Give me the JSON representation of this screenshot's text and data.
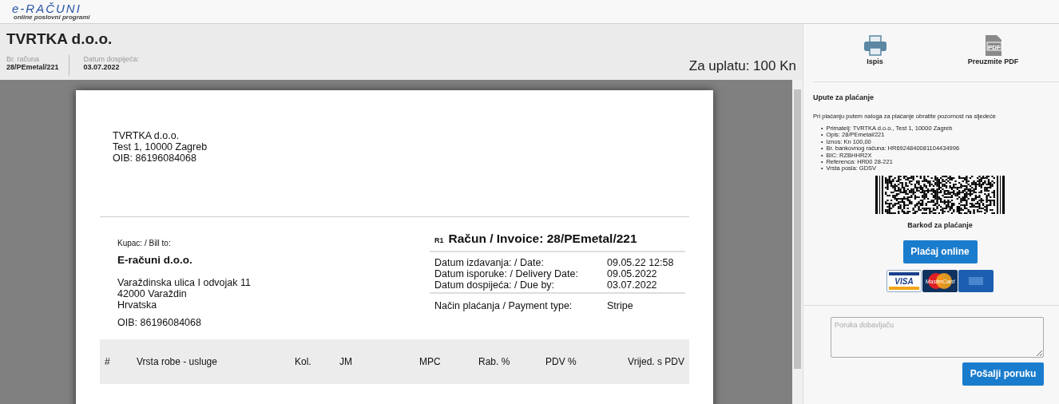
{
  "logo": {
    "name": "e-RAČUNI",
    "tagline": "online poslovni programi"
  },
  "header": {
    "company": "TVRTKA d.o.o.",
    "fields": [
      {
        "label": "Br. računa",
        "value": "28/PEmetal/221"
      },
      {
        "label": "Datum dospijeća:",
        "value": "03.07.2022"
      }
    ],
    "amount_due": "Za uplatu: 100 Kn"
  },
  "document": {
    "seller_lines": [
      "TVRTKA d.o.o.",
      "Test 1, 10000 Zagreb",
      "OIB: 86196084068"
    ],
    "buyer": {
      "label": "Kupac: / Bill to:",
      "name": "E-računi d.o.o.",
      "address_lines": [
        "Varaždinska ulica I odvojak 11",
        "42000 Varaždin",
        "Hrvatska"
      ],
      "oib": "OIB: 86196084068"
    },
    "invoice": {
      "prefix": "R1",
      "title": "Račun / Invoice: 28/PEmetal/221",
      "dates": [
        {
          "label": "Datum izdavanja: / Date:",
          "value": "09.05.22 12:58"
        },
        {
          "label": "Datum isporuke: / Delivery Date:",
          "value": "09.05.2022"
        },
        {
          "label": "Datum dospijeća: / Due by:",
          "value": "03.07.2022"
        }
      ],
      "payment": {
        "label": "Način plaćanja / Payment type:",
        "value": "Stripe"
      }
    },
    "table": {
      "columns": [
        "#",
        "Vrsta robe - usluge",
        "Kol.",
        "JM",
        "MPC",
        "Rab. %",
        "PDV %",
        "Vrijed. s PDV"
      ]
    }
  },
  "actions": [
    {
      "kind": "print",
      "label": "Ispis"
    },
    {
      "kind": "pdf",
      "label": "Preuzmite PDF",
      "icon_text": "PDF"
    }
  ],
  "payment": {
    "title": "Upute za plaćanje",
    "intro": "Pri plaćanju putem naloga za plaćanje obratite pozornost na sljedeće",
    "marker": "•",
    "items": [
      "Primatelj: TVRTKA d.o.o., Test 1, 10000 Zagreb",
      "Opis: 28/PEmetal/221",
      "Iznos: Kn 100,00",
      "Br. bankovnog računa: HR6924840081104434996",
      "BIC: RZBHHR2X",
      "Referenca: HR00 28-221",
      "Vrsta posla: GDSV"
    ],
    "barcode_caption": "Barkod za plaćanje",
    "pay_button": "Plaćaj online",
    "cards": [
      {
        "kind": "visa",
        "label": "VISA"
      },
      {
        "kind": "mastercard",
        "label": "MasterCard"
      },
      {
        "kind": "amex"
      }
    ]
  },
  "message": {
    "placeholder": "Poruka dobavljaču",
    "send_button": "Pošalji poruku"
  }
}
